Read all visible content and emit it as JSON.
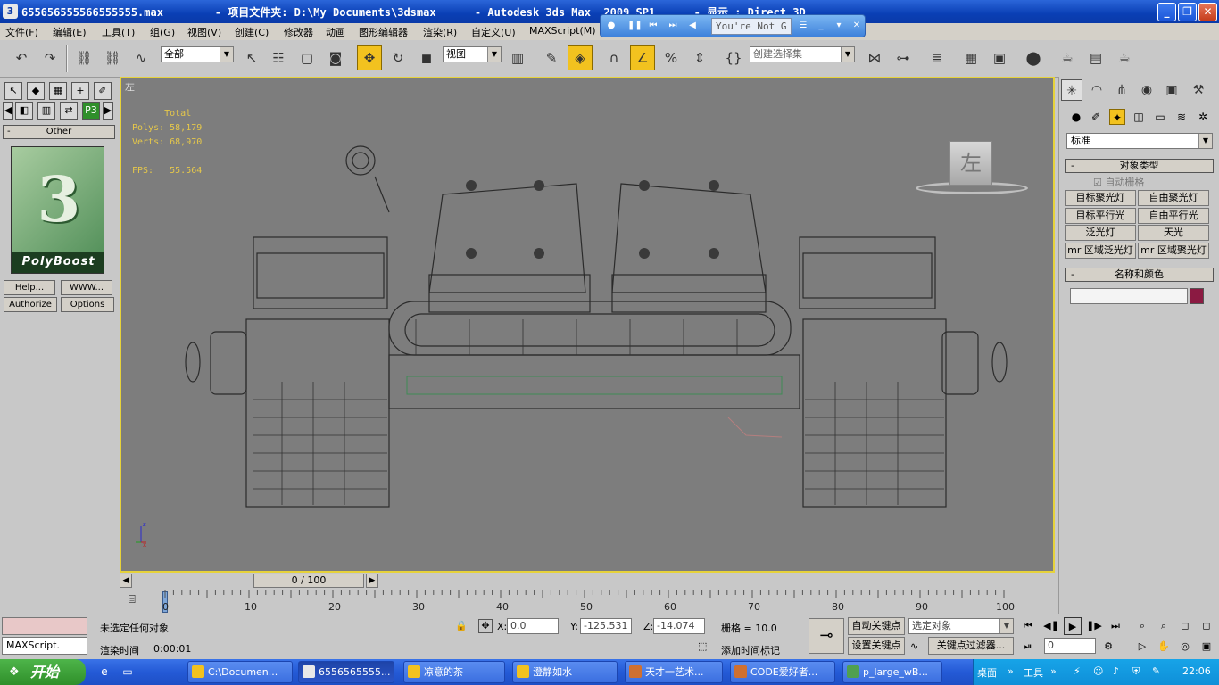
{
  "window": {
    "title": "655656555566555555.max        - 项目文件夹: D:\\My Documents\\3dsmax      - Autodesk 3ds Max  2009 SP1      - 显示 : Direct 3D",
    "minimize": "_",
    "maximize": "❐",
    "close": "✕"
  },
  "media_bar": {
    "text": "You're Not G"
  },
  "menu": [
    "文件(F)",
    "编辑(E)",
    "工具(T)",
    "组(G)",
    "视图(V)",
    "创建(C)",
    "修改器",
    "动画",
    "图形编辑器",
    "渲染(R)",
    "自定义(U)",
    "MAXScript(M)"
  ],
  "toolbar": {
    "selection_filter": "全部",
    "ref_coord": "视图",
    "named_selection": "创建选择集"
  },
  "left_panel": {
    "rollout": "Other",
    "logo_text": "PolyBoost",
    "buttons": [
      "Help...",
      "WWW...",
      "Authorize",
      "Options"
    ]
  },
  "viewport": {
    "label": "左",
    "stats": "      Total\nPolys: 58,179\nVerts: 68,970\n\nFPS:   55.564",
    "viewcube_face": "左"
  },
  "timeline": {
    "slider": "0 / 100",
    "ticks": [
      "0",
      "10",
      "20",
      "30",
      "40",
      "50",
      "60",
      "70",
      "80",
      "90",
      "100"
    ]
  },
  "command_panel": {
    "category": "标准",
    "object_type_title": "对象类型",
    "auto_grid": "自动栅格",
    "buttons": [
      "目标聚光灯",
      "自由聚光灯",
      "目标平行光",
      "自由平行光",
      "泛光灯",
      "天光",
      "mr 区域泛光灯",
      "mr 区域聚光灯"
    ],
    "name_color_title": "名称和颜色"
  },
  "status": {
    "maxscript": "MAXScript.",
    "selection": "未选定任何对象",
    "render_time_label": "渲染时间",
    "render_time": "0:00:01",
    "x_label": "X:",
    "x": "0.0",
    "y_label": "Y:",
    "y": "-125.531",
    "z_label": "Z:",
    "z": "-14.074",
    "grid": "栅格 = 10.0",
    "add_time_tag": "添加时间标记",
    "auto_key": "自动关键点",
    "set_key": "设置关键点",
    "selected_object": "选定对象",
    "key_filters": "关键点过滤器...",
    "frame": "0"
  },
  "taskbar": {
    "start": "开始",
    "tasks": [
      "C:\\Documen...",
      "6556565555...",
      "凉意的茶",
      "澄静如水",
      "天才一艺术...",
      "CODE爱好者...",
      "p_large_wB..."
    ],
    "tray_desktop": "桌面",
    "tray_tools": "工具",
    "clock": "22:06"
  }
}
